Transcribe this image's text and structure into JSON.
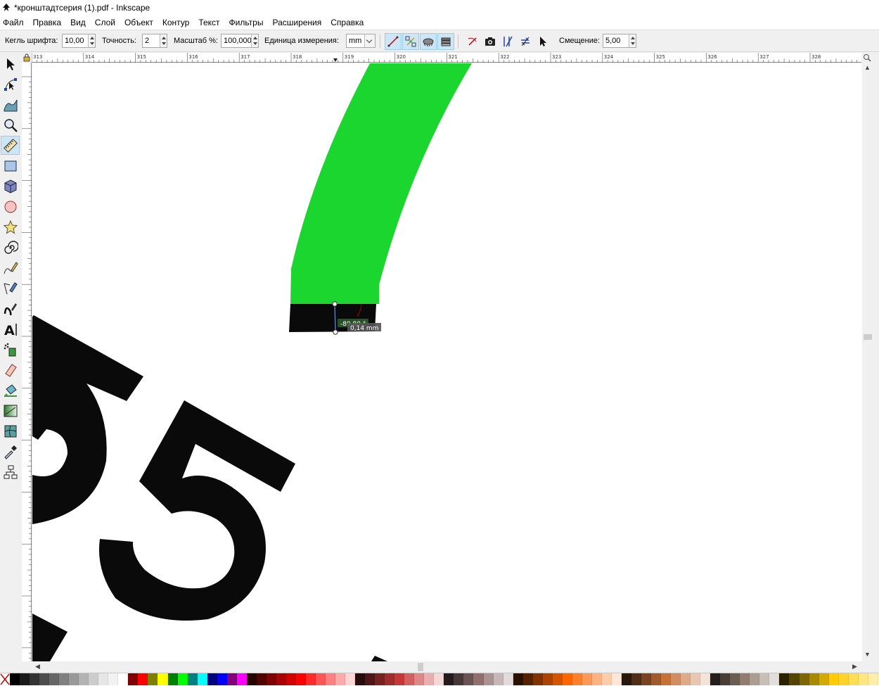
{
  "window": {
    "title": "*кронштадтсерия (1).pdf - Inkscape"
  },
  "menu": [
    "Файл",
    "Правка",
    "Вид",
    "Слой",
    "Объект",
    "Контур",
    "Текст",
    "Фильтры",
    "Расширения",
    "Справка"
  ],
  "tool_controls": {
    "font_size_label": "Кегль шрифта:",
    "font_size_value": "10,00",
    "precision_label": "Точность:",
    "precision_value": "2",
    "scale_label": "Масштаб %:",
    "scale_value": "100,000",
    "unit_label": "Единица измерения:",
    "unit_value": "mm",
    "offset_label": "Смещение:",
    "offset_value": "5,00"
  },
  "ruler": {
    "h_labels": [
      "313",
      "314",
      "315",
      "316",
      "317",
      "318",
      "319",
      "320",
      "321",
      "322",
      "323",
      "324",
      "325",
      "326",
      "327",
      "328"
    ]
  },
  "measure": {
    "angle": "-89,80 °",
    "length": "0,14 mm"
  },
  "colors": {
    "green_shape": "#1ad62f",
    "black_shape": "#0a0a0a",
    "active_bg": "#cde6f7"
  },
  "palette": [
    "#000000",
    "#1a1a1a",
    "#333333",
    "#4d4d4d",
    "#666666",
    "#808080",
    "#999999",
    "#b3b3b3",
    "#cccccc",
    "#e6e6e6",
    "#f2f2f2",
    "#ffffff",
    "#800000",
    "#ff0000",
    "#808000",
    "#ffff00",
    "#008000",
    "#00ff00",
    "#008080",
    "#00ffff",
    "#000080",
    "#0000ff",
    "#800080",
    "#ff00ff",
    "#2b0000",
    "#550000",
    "#800000",
    "#aa0000",
    "#d40000",
    "#ff0000",
    "#ff2a2a",
    "#ff5555",
    "#ff8080",
    "#ffaaaa",
    "#ffd5d5",
    "#280b0b",
    "#501616",
    "#782121",
    "#a02c2c",
    "#c83737",
    "#d35f5f",
    "#de8787",
    "#e9afaf",
    "#f4d7d7",
    "#241c1c",
    "#483737",
    "#6c5353",
    "#916f6f",
    "#ac9393",
    "#c8b7b7",
    "#e3dbdb",
    "#2b1100",
    "#552200",
    "#803300",
    "#aa4400",
    "#d45500",
    "#ff6600",
    "#ff7f2a",
    "#ff9955",
    "#ffb380",
    "#ffccaa",
    "#ffe6d5",
    "#28170b",
    "#502d16",
    "#784421",
    "#a05a2c",
    "#c87137",
    "#d38d5f",
    "#deaa87",
    "#e9c6af",
    "#f4e3d7",
    "#241f1c",
    "#483e37",
    "#6c5d53",
    "#917c6f",
    "#ac9d93",
    "#c8beb7",
    "#e3dedb",
    "#2b2200",
    "#554400",
    "#806600",
    "#aa8800",
    "#d4aa00",
    "#ffcc00",
    "#ffd42a",
    "#ffdd55",
    "#ffe680",
    "#ffeeaa"
  ]
}
